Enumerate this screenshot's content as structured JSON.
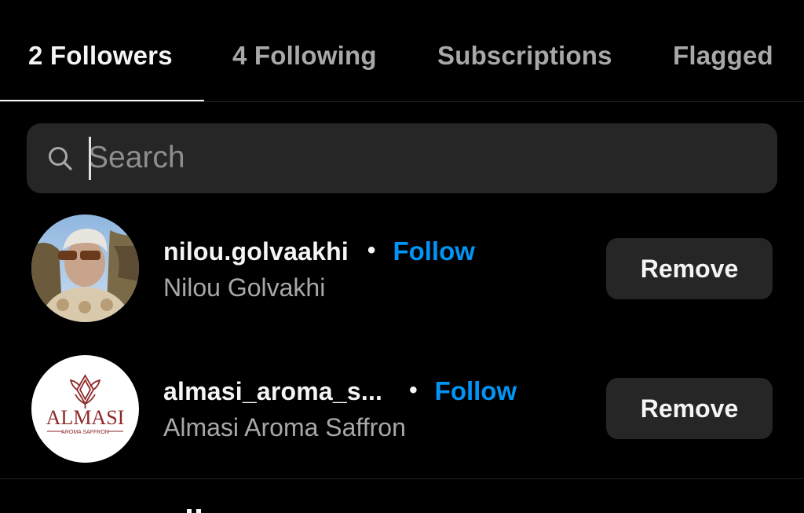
{
  "tabs": [
    {
      "label": "2 Followers",
      "active": true
    },
    {
      "label": "4 Following",
      "active": false
    },
    {
      "label": "Subscriptions",
      "active": false
    },
    {
      "label": "Flagged",
      "active": false
    }
  ],
  "search": {
    "placeholder": "Search",
    "value": ""
  },
  "followers": [
    {
      "username": "nilou.golvaakhi",
      "full_name": "Nilou Golvakhi",
      "follow_label": "Follow",
      "remove_label": "Remove"
    },
    {
      "username": "almasi_aroma_s...",
      "full_name": "Almasi Aroma Saffron",
      "follow_label": "Follow",
      "remove_label": "Remove",
      "logo_text": "ALMASI",
      "logo_subtext": "AROMA SAFFRON"
    }
  ],
  "colors": {
    "background": "#000000",
    "surface": "#262626",
    "text_primary": "#f5f5f5",
    "text_secondary": "#a8a8a8",
    "link": "#0095f6",
    "logo_red": "#8e2a2a"
  },
  "icons": {
    "search": "magnifying-glass"
  }
}
